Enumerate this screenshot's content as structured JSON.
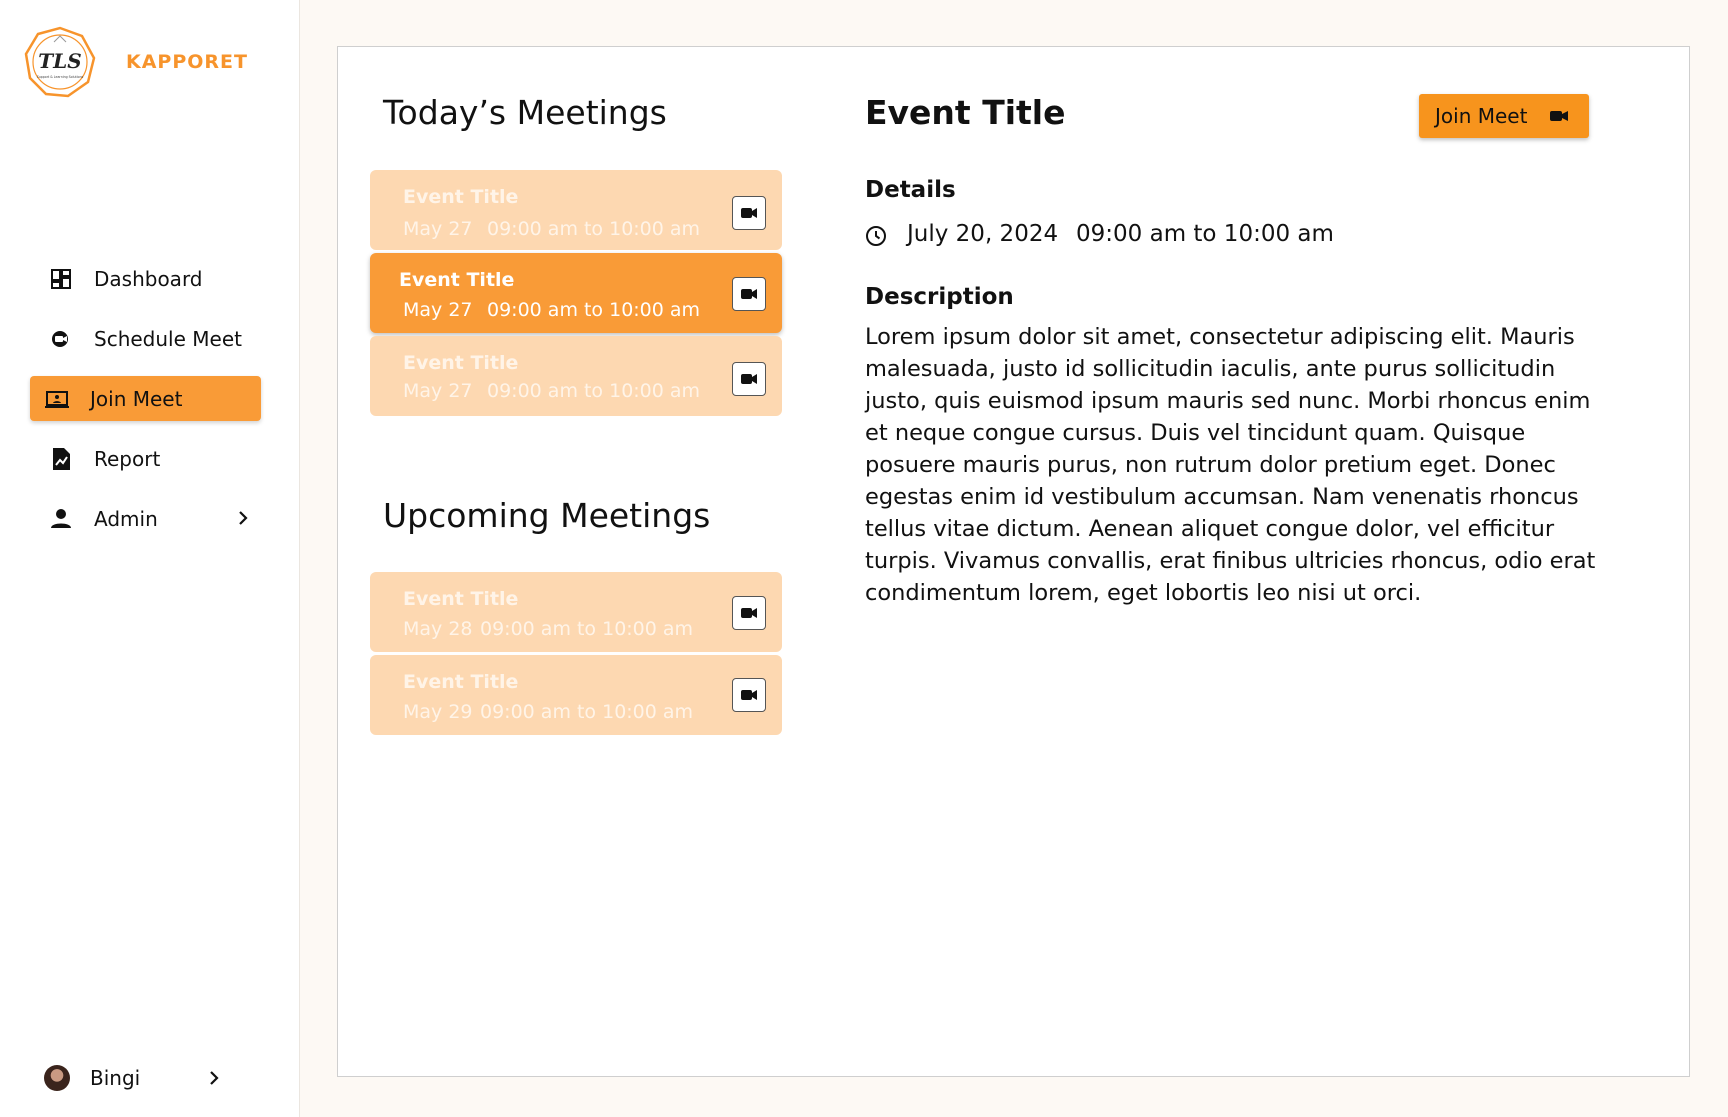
{
  "brand": {
    "name": "KAPPORET",
    "logo_text": "TLS",
    "logo_subtitle": "Support & Learning Solutions",
    "accent": "#f7942c"
  },
  "sidebar": {
    "items": [
      {
        "label": "Dashboard",
        "icon": "dashboard-icon"
      },
      {
        "label": "Schedule Meet",
        "icon": "video-chat-icon"
      },
      {
        "label": "Join Meet",
        "icon": "laptop-user-icon",
        "active": true
      },
      {
        "label": "Report",
        "icon": "report-icon"
      },
      {
        "label": "Admin",
        "icon": "person-icon",
        "has_chevron": true
      }
    ],
    "user": {
      "name": "Bingi"
    }
  },
  "today": {
    "heading": "Today’s Meetings",
    "meetings": [
      {
        "title": "Event Title",
        "date": "May 27",
        "time": "09:00 am to 10:00 am",
        "selected": false
      },
      {
        "title": "Event Title",
        "date": "May 27",
        "time": "09:00 am to 10:00 am",
        "selected": true
      },
      {
        "title": "Event Title",
        "date": "May 27",
        "time": "09:00 am to 10:00 am",
        "selected": false
      }
    ]
  },
  "upcoming": {
    "heading": "Upcoming Meetings",
    "meetings": [
      {
        "title": "Event Title",
        "date": "May 28",
        "time": "09:00 am to 10:00 am"
      },
      {
        "title": "Event Title",
        "date": "May 29",
        "time": "09:00 am to 10:00 am"
      }
    ]
  },
  "detail": {
    "title": "Event Title",
    "join_label": "Join Meet",
    "details_label": "Details",
    "date": "July 20, 2024",
    "time": "09:00 am to 10:00 am",
    "description_label": "Description",
    "description": "Lorem ipsum dolor sit amet, consectetur adipiscing elit. Mauris malesuada, justo id sollicitudin iaculis, ante purus sollicitudin justo, quis euismod ipsum mauris sed nunc. Morbi rhoncus enim et neque congue cursus. Duis vel tincidunt quam. Quisque posuere mauris purus, non rutrum dolor pretium eget. Donec egestas enim id vestibulum accumsan. Nam venenatis rhoncus tellus vitae dictum. Aenean aliquet congue dolor, vel efficitur turpis. Vivamus convallis, erat finibus ultricies rhoncus, odio erat condimentum lorem, eget lobortis leo nisi ut orci."
  }
}
